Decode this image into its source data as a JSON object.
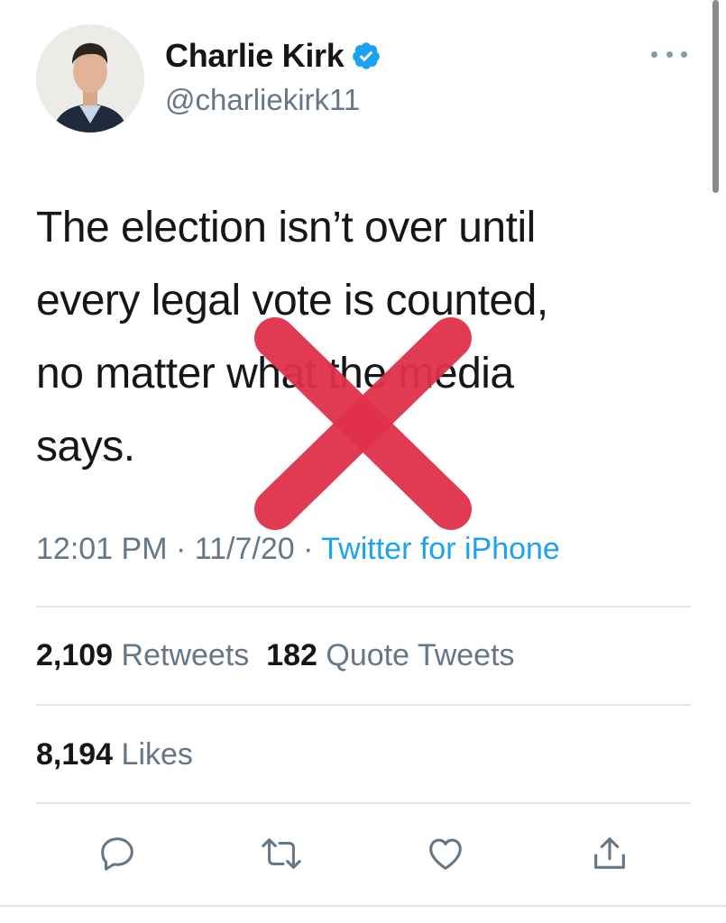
{
  "author": {
    "name": "Charlie Kirk",
    "handle": "@charliekirk11",
    "verified": true,
    "avatar_icon": "profile-photo"
  },
  "tweet": {
    "lines": [
      "The election isn’t over until",
      "every legal vote is counted,",
      "no matter what the media",
      "says."
    ],
    "time": "12:01 PM",
    "date": "11/7/20",
    "separator": " · ",
    "source": "Twitter for iPhone"
  },
  "stats": {
    "retweets_count": "2,109",
    "retweets_label": "Retweets",
    "quotes_count": "182",
    "quotes_label": "Quote Tweets",
    "likes_count": "8,194",
    "likes_label": "Likes"
  },
  "overlay": {
    "type": "x-mark",
    "color": "#e0304a"
  },
  "colors": {
    "text": "#14171a",
    "secondary": "#657786",
    "link": "#1da1f2",
    "verified": "#1da1f2",
    "divider": "#e1e8ed"
  },
  "actions": [
    "reply-icon",
    "retweet-icon",
    "like-icon",
    "share-icon"
  ]
}
